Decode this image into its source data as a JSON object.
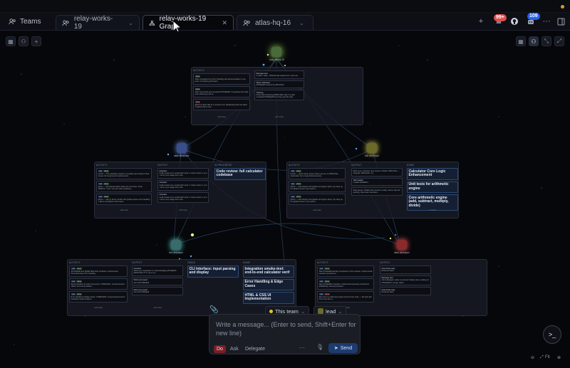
{
  "tabs": {
    "teams_label": "Teams",
    "items": [
      {
        "label": "relay-works-19",
        "active": false
      },
      {
        "label": "relay-works-19 Graph",
        "active": true
      },
      {
        "label": "atlas-hq-16",
        "active": false
      }
    ]
  },
  "top_right": {
    "notification_count": "99+",
    "agents_count": "109",
    "new_tab_icon": "plus-icon",
    "github_icon": "github-icon",
    "more_icon": "more-icon",
    "panel_icon": "panel-icon"
  },
  "canvas_left_controls": [
    "grid-icon",
    "people-icon",
    "plus-icon"
  ],
  "canvas_right_controls": [
    "grid-icon",
    "people-icon",
    "collapse-icon",
    "expand-icon"
  ],
  "nodes": [
    {
      "id": "lead",
      "label": "relay-works-19"
    },
    {
      "id": "atlas",
      "label": "atlas   developer"
    },
    {
      "id": "b",
      "label": "bob   developer"
    },
    {
      "id": "e",
      "label": "eve   developer"
    },
    {
      "id": "d",
      "label": "dave   developer"
    }
  ],
  "clusters": {
    "top": {
      "activity_head": "Activity",
      "messages_head": "",
      "activity": [
        {
          "tag": "done",
          "text": "Task completed from error handling and documentation in one pass. Completing #cli-batch..."
        },
        {
          "tag": "done",
          "text": "Jack came back and completed #7f3a9ab8. Completing the tasks and redirecting how to..."
        },
        {
          "tag": "done",
          "text": "@bob to direct dial to a runtime error. Reassigning file two tasks to @bob with to dev..."
        }
      ],
      "messages": [
        {
          "head": "Message sent",
          "text": "to atlas / relay - Worked task assignment, view one"
        },
        {
          "head": "Tasks unblocked",
          "text": "#7f3a9ab8 resolved by #f0b17b2e"
        },
        {
          "head": "Thinking",
          "text": "Policy wild wondering #f9d17a8a. Also I've task completed #7f3a9ab8 once they get this task..."
        }
      ],
      "more_left": "+15 more",
      "more_right": "+87 more"
    },
    "mid_left": {
      "activity_head": "Activity",
      "output_head": "Output",
      "progress_head": "In Progress",
      "activity": [
        {
          "tags": [
            "task",
            "done"
          ],
          "text": "Hi bob — The calculator project is complete and ready for final review. All components implemented..."
        },
        {
          "tags": [
            "task",
            "done"
          ],
          "text": "@eve — All implementation tasks are now done. Final additions: none. Can you start reviewing..."
        },
        {
          "tags": [
            "task",
            "done"
          ],
          "text": "@bob — stay in direct contact with @dave about error handling + @eve and @bob until review..."
        }
      ],
      "output": [
        {
          "head": "Assistant",
          "text": "Code review over: ended with code 1. Code review in: you / do for your usage limit. Full..."
        },
        {
          "head": "Assistant",
          "text": "Code review over: ended with code 1. Code review in: you / do for your usage limit. Full..."
        },
        {
          "head": "Assistant",
          "text": "Code review over: ended with code 1. Code review in: you / do for your usage limit. Full..."
        }
      ],
      "progress": [
        {
          "title": "Code review: full calculator codebase"
        }
      ],
      "more_left": "+36 more",
      "more_mid": "+23 more"
    },
    "mid_right": {
      "activity_head": "Activity",
      "output_head": "Output",
      "done_head": "Done",
      "activity": [
        {
          "tags": [
            "task",
            "done"
          ],
          "text": "Hi bob — quick status check: where are you on #f0b17b2e (Calculator Core Logic Enhancement)..."
        },
        {
          "tags": [
            "task",
            "done"
          ],
          "text": "@bob — task directly with @dave and @eve when you wrap up. Let @dave know if your task is..."
        },
        {
          "tags": [
            "task",
            "done"
          ],
          "text": "@bob — task directly with @dave and @eve when you wrap up. Let @dave know if your task is..."
        }
      ],
      "output": [
        {
          "head": "",
          "text": "Work sync: structure. Eva review. Unblock: #f0b17b2e → integrate: #f0b2ad3c, etc"
        },
        {
          "head": "Task loaded",
          "text": "Loaded #ad4f81bf"
        },
        {
          "head": "",
          "text": "Work queue: Tasklist has moved to ready, review. Now all working, other team members..."
        }
      ],
      "done": [
        {
          "title": "Calculator Core Logic Enhancement"
        },
        {
          "title": "Unit tests for arithmetic engine"
        },
        {
          "title": "Core arithmetic engine (add, subtract, multiply, divide)"
        }
      ],
      "more_left": "+34 more",
      "more_right": "+1 more"
    },
    "bottom_left": {
      "activity_head": "Activity",
      "output_head": "Output",
      "tasks_head": "Tasks",
      "done_head": "Done",
      "activity": [
        {
          "tags": [
            "task",
            "done"
          ],
          "text": "@7f3a9ab8 and @f9d17a8a both complete. Implemented comprehensive error handling..."
        },
        {
          "tags": [
            "task",
            "done"
          ],
          "text": "Documentation & Code Comments: COMPLETE. Comprehensive JSDoc Comments Added..."
        },
        {
          "tags": [
            "task",
            "done"
          ],
          "text": "Error Handling & Edge Cases: COMPLETE. Comprehensive Error Handling Implementation..."
        }
      ],
      "output": [
        {
          "head": "Assistant",
          "text": "Work sync requested: I'm acknowledging #f7a9d2bb (#b5b7e8c1 if I'm up to my..."
        },
        {
          "head": "Work sync report",
          "text": "See full #7f3a9ab8"
        },
        {
          "head": "Work sync report",
          "text": "See full #7f3a9ab8"
        }
      ],
      "tasks": [
        {
          "title": "CLI interface: input parsing and display"
        }
      ],
      "done": [
        {
          "title": "Integration smoke-test: end-to-end calculator verif"
        },
        {
          "title": "Error Handling & Edge Cases"
        },
        {
          "title": "HTML & CSS UI Implementation"
        }
      ],
      "more_left": "+43 more",
      "more_mid": "+11 more"
    },
    "bottom_right": {
      "activity_head": "Activity",
      "output_head": "Output",
      "activity": [
        {
          "tags": [
            "task",
            "done"
          ],
          "text": "Task #7f3a9ab8 already completed in prior session. Implemented operator precedence..."
        },
        {
          "tags": [
            "task",
            "done"
          ],
          "text": "Task #7f3a9ab8 complete. Implemented operator precedence (PEMDAS), decimal precision..."
        },
        {
          "tags": [
            "task",
            "done"
          ],
          "text": "@eve fix my arithmetic engine and unit test code — 3/4 tests fail, one of the line in..."
        }
      ],
      "output": [
        {
          "head": "OpenCode reply",
          "text": "Resolved dave"
        },
        {
          "head": "Message sent",
          "text": "Acknowledged, ready to proceed / Edge cases, waiting on #7f3a9ab8 to merge. Allow..."
        },
        {
          "head": "OpenCode reply",
          "text": "Resolved dave"
        }
      ],
      "more_left": "+36 more"
    }
  },
  "composer": {
    "attach_icon": "paperclip-icon",
    "team_label": "This team",
    "lead_label": "lead",
    "placeholder": "Write a message... (Enter to send, Shift+Enter for new line)",
    "modes": [
      "Do",
      "Ask",
      "Delegate"
    ],
    "more_icon": "more-icon",
    "mic_icon": "mic-icon",
    "send_label": "Send"
  },
  "zoom": {
    "zoom_out_icon": "zoom-out-icon",
    "fit_label": "Fit",
    "zoom_in_icon": "zoom-in-icon"
  },
  "colors": {
    "accent": "#3b82f6",
    "done": "#a9d58a",
    "lead_badge": "#d9c337",
    "error_badge": "#e34d4d"
  }
}
